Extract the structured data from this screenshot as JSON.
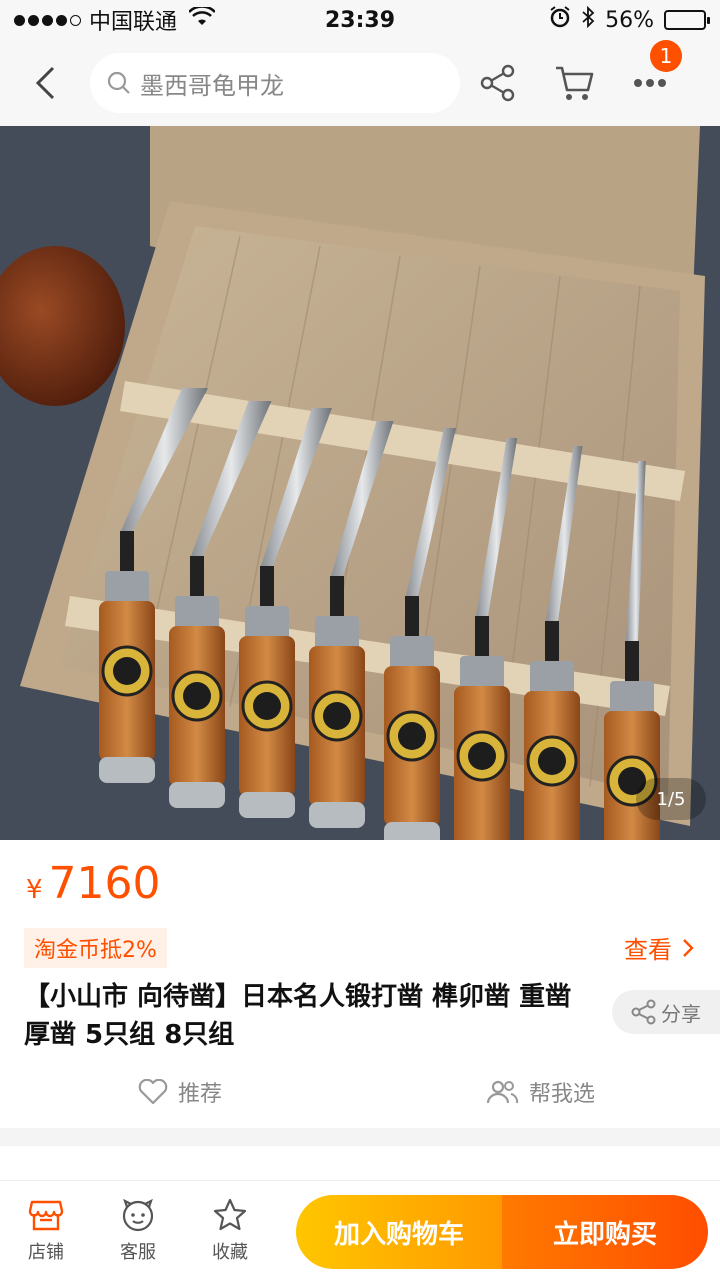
{
  "status_bar": {
    "carrier": "中国联通",
    "time": "23:39",
    "battery_percent": "56%",
    "battery_level": 0.56
  },
  "nav": {
    "search_text": "墨西哥龟甲龙",
    "cart_badge": "1"
  },
  "gallery": {
    "counter": "1/5"
  },
  "product": {
    "currency": "¥",
    "price": "7160",
    "coin_tag": "淘金币抵2%",
    "view_link": "查看",
    "title": "【小山市 向待凿】日本名人锻打凿 榫卯凿 重凿 厚凿 5只组 8只组",
    "share_label": "分享",
    "recommend_label": "推荐",
    "help_choose_label": "帮我选"
  },
  "bottom_bar": {
    "shop_label": "店铺",
    "service_label": "客服",
    "favorite_label": "收藏",
    "add_to_cart_label": "加入购物车",
    "buy_now_label": "立即购买"
  },
  "colors": {
    "accent": "#ff5000",
    "cart_gradient_start": "#ffc600",
    "buy_gradient_end": "#ff4d00"
  }
}
